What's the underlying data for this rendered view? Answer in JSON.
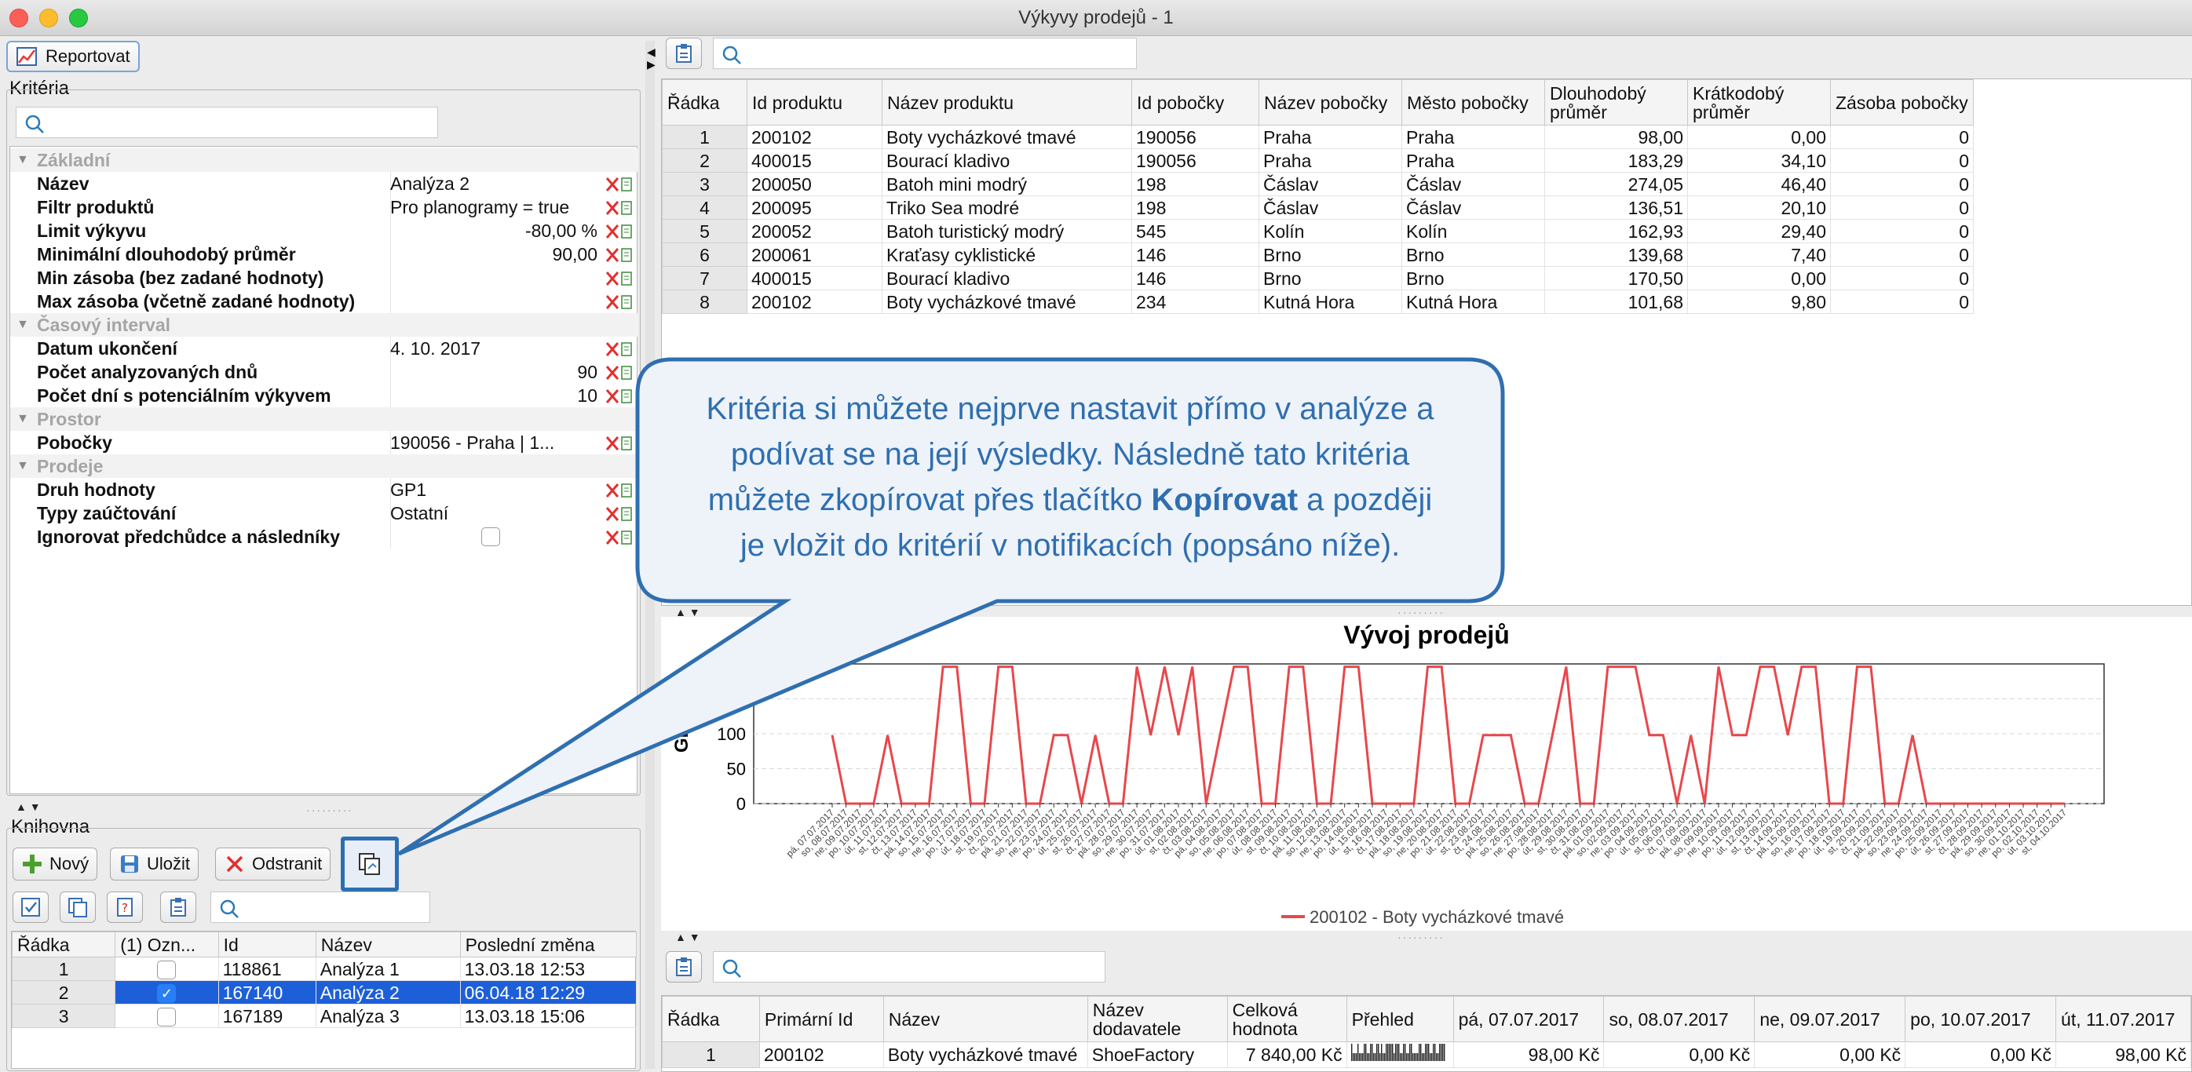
{
  "window": {
    "title": "Výkyvy prodejů - 1"
  },
  "toolbar": {
    "report_label": "Reportovat"
  },
  "criteria": {
    "section_title": "Kritéria",
    "groups": [
      {
        "name": "Základní",
        "rows": [
          {
            "key": "Název",
            "value": "Analýza 2",
            "align": "left"
          },
          {
            "key": "Filtr produktů",
            "value": "Pro planogramy = true",
            "align": "left"
          },
          {
            "key": "Limit výkyvu",
            "value": "-80,00 %",
            "align": "right"
          },
          {
            "key": "Minimální dlouhodobý průměr",
            "value": "90,00",
            "align": "right"
          },
          {
            "key": "Min zásoba (bez zadané hodnoty)",
            "value": "",
            "align": "left"
          },
          {
            "key": "Max zásoba (včetně zadané hodnoty)",
            "value": "",
            "align": "left"
          }
        ]
      },
      {
        "name": "Časový interval",
        "rows": [
          {
            "key": "Datum ukončení",
            "value": "4. 10. 2017",
            "align": "left"
          },
          {
            "key": "Počet analyzovaných dnů",
            "value": "90",
            "align": "right"
          },
          {
            "key": "Počet dní s potenciálním výkyvem",
            "value": "10",
            "align": "right"
          }
        ]
      },
      {
        "name": "Prostor",
        "rows": [
          {
            "key": "Pobočky",
            "value": "190056 - Praha  | 1...",
            "align": "left"
          }
        ]
      },
      {
        "name": "Prodeje",
        "rows": [
          {
            "key": "Druh hodnoty",
            "value": "GP1",
            "align": "left"
          },
          {
            "key": "Typy zaúčtování",
            "value": "Ostatní",
            "align": "left"
          },
          {
            "key": "Ignorovat předchůdce a následníky",
            "value": "",
            "align": "checkbox"
          }
        ]
      }
    ]
  },
  "library": {
    "section_title": "Knihovna",
    "new_label": "Nový",
    "save_label": "Uložit",
    "delete_label": "Odstranit",
    "columns": [
      "Řádka",
      "(1) Ozn...",
      "Id",
      "Název",
      "Poslední změna"
    ],
    "rows": [
      {
        "n": "1",
        "checked": false,
        "id": "118861",
        "name": "Analýza 1",
        "changed": "13.03.18 12:53",
        "selected": false
      },
      {
        "n": "2",
        "checked": true,
        "id": "167140",
        "name": "Analýza 2",
        "changed": "06.04.18 12:29",
        "selected": true
      },
      {
        "n": "3",
        "checked": false,
        "id": "167189",
        "name": "Analýza 3",
        "changed": "13.03.18 15:06",
        "selected": false
      }
    ]
  },
  "results": {
    "columns": [
      "Řádka",
      "Id produktu",
      "Název produktu",
      "Id pobočky",
      "Název pobočky",
      "Město pobočky",
      "Dlouhodobý průměr",
      "Krátkodobý průměr",
      "Zásoba pobočky"
    ],
    "rows": [
      [
        "1",
        "200102",
        "Boty vycházkové tmavé",
        "190056",
        "Praha",
        "Praha",
        "98,00",
        "0,00",
        "0"
      ],
      [
        "2",
        "400015",
        "Bourací kladivo",
        "190056",
        "Praha",
        "Praha",
        "183,29",
        "34,10",
        "0"
      ],
      [
        "3",
        "200050",
        "Batoh mini modrý",
        "198",
        "Čáslav",
        "Čáslav",
        "274,05",
        "46,40",
        "0"
      ],
      [
        "4",
        "200095",
        "Triko Sea modré",
        "198",
        "Čáslav",
        "Čáslav",
        "136,51",
        "20,10",
        "0"
      ],
      [
        "5",
        "200052",
        "Batoh turistický modrý",
        "545",
        "Kolín",
        "Kolín",
        "162,93",
        "29,40",
        "0"
      ],
      [
        "6",
        "200061",
        "Kraťasy cyklistické",
        "146",
        "Brno",
        "Brno",
        "139,68",
        "7,40",
        "0"
      ],
      [
        "7",
        "400015",
        "Bourací kladivo",
        "146",
        "Brno",
        "Brno",
        "170,50",
        "0,00",
        "0"
      ],
      [
        "8",
        "200102",
        "Boty vycházkové tmavé",
        "234",
        "Kutná Hora",
        "Kutná Hora",
        "101,68",
        "9,80",
        "0"
      ]
    ]
  },
  "callout": {
    "line1": "Kritéria si můžete nejprve nastavit přímo v analýze a",
    "line2": "podívat se na její výsledky. Následně tato kritéria",
    "line3_before": "můžete zkopírovat přes tlačítko ",
    "line3_bold": "Kopírovat",
    "line3_after": " a později",
    "line4": "je vložit do kritérií v notifikacích (popsáno níže)."
  },
  "chart_data": {
    "type": "line",
    "title": "Vývoj prodejů",
    "ylabel": "GP1",
    "yticks": [
      "0",
      "50",
      "100",
      "150"
    ],
    "ylim": [
      0,
      200
    ],
    "grid": true,
    "legend_position": "bottom",
    "color": "#e8474c",
    "x": [
      "pá, 07.07.2017",
      "so, 08.07.2017",
      "ne, 09.07.2017",
      "po, 10.07.2017",
      "út, 11.07.2017",
      "st, 12.07.2017",
      "čt, 13.07.2017",
      "pá, 14.07.2017",
      "so, 15.07.2017",
      "ne, 16.07.2017",
      "po, 17.07.2017",
      "út, 18.07.2017",
      "st, 19.07.2017",
      "čt, 20.07.2017",
      "pá, 21.07.2017",
      "so, 22.07.2017",
      "ne, 23.07.2017",
      "po, 24.07.2017",
      "út, 25.07.2017",
      "st, 26.07.2017",
      "čt, 27.07.2017",
      "pá, 28.07.2017",
      "so, 29.07.2017",
      "ne, 30.07.2017",
      "po, 31.07.2017",
      "út, 01.08.2017",
      "st, 02.08.2017",
      "čt, 03.08.2017",
      "pá, 04.08.2017",
      "so, 05.08.2017",
      "ne, 06.08.2017",
      "po, 07.08.2017",
      "út, 08.08.2017",
      "st, 09.08.2017",
      "čt, 10.08.2017",
      "pá, 11.08.2017",
      "so, 12.08.2017",
      "ne, 13.08.2017",
      "po, 14.08.2017",
      "út, 15.08.2017",
      "st, 16.08.2017",
      "čt, 17.08.2017",
      "pá, 18.08.2017",
      "so, 19.08.2017",
      "ne, 20.08.2017",
      "po, 21.08.2017",
      "út, 22.08.2017",
      "st, 23.08.2017",
      "čt, 24.08.2017",
      "pá, 25.08.2017",
      "so, 26.08.2017",
      "ne, 27.08.2017",
      "po, 28.08.2017",
      "út, 29.08.2017",
      "st, 30.08.2017",
      "čt, 31.08.2017",
      "pá, 01.09.2017",
      "so, 02.09.2017",
      "ne, 03.09.2017",
      "po, 04.09.2017",
      "út, 05.09.2017",
      "st, 06.09.2017",
      "čt, 07.09.2017",
      "pá, 08.09.2017",
      "so, 09.09.2017",
      "ne, 10.09.2017",
      "po, 11.09.2017",
      "út, 12.09.2017",
      "st, 13.09.2017",
      "čt, 14.09.2017",
      "pá, 15.09.2017",
      "so, 16.09.2017",
      "ne, 17.09.2017",
      "po, 18.09.2017",
      "út, 19.09.2017",
      "st, 20.09.2017",
      "čt, 21.09.2017",
      "pá, 22.09.2017",
      "so, 23.09.2017",
      "ne, 24.09.2017",
      "po, 25.09.2017",
      "út, 26.09.2017",
      "st, 27.09.2017",
      "čt, 28.09.2017",
      "pá, 29.09.2017",
      "so, 30.09.2017",
      "ne, 01.10.2017",
      "po, 02.10.2017",
      "út, 03.10.2017",
      "st, 04.10.2017"
    ],
    "series": [
      {
        "name": "200102 - Boty vycházkové tmavé",
        "values": [
          98,
          0,
          0,
          0,
          98,
          0,
          0,
          0,
          196,
          196,
          0,
          0,
          196,
          196,
          0,
          0,
          98,
          98,
          0,
          98,
          0,
          0,
          196,
          98,
          196,
          98,
          196,
          0,
          98,
          196,
          196,
          0,
          0,
          196,
          196,
          0,
          0,
          196,
          196,
          0,
          0,
          0,
          0,
          196,
          196,
          0,
          0,
          98,
          98,
          98,
          0,
          0,
          98,
          196,
          0,
          0,
          196,
          196,
          196,
          98,
          98,
          0,
          98,
          0,
          196,
          98,
          98,
          196,
          196,
          98,
          196,
          196,
          0,
          0,
          196,
          196,
          0,
          0,
          98,
          0,
          0,
          0,
          0,
          0,
          0,
          0,
          0,
          0,
          0,
          0
        ]
      }
    ]
  },
  "detail": {
    "columns": [
      "Řádka",
      "Primární Id",
      "Název",
      "Název dodavatele",
      "Celková hodnota",
      "Přehled",
      "pá, 07.07.2017",
      "so, 08.07.2017",
      "ne, 09.07.2017",
      "po, 10.07.2017",
      "út, 11.07.2017"
    ],
    "rows": [
      [
        "1",
        "200102",
        "Boty vycházkové tmavé",
        "ShoeFactory",
        "7 840,00 Kč",
        "",
        "98,00 Kč",
        "0,00 Kč",
        "0,00 Kč",
        "0,00 Kč",
        "98,00 Kč"
      ]
    ]
  }
}
